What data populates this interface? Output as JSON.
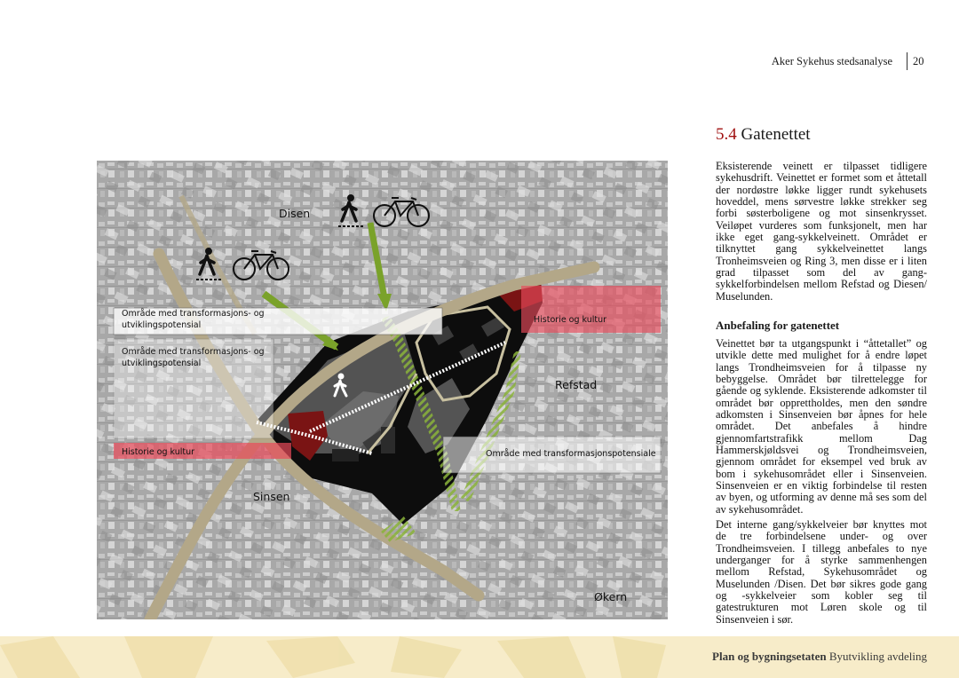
{
  "header": {
    "title": "Aker Sykehus stedsanalyse",
    "page": "20"
  },
  "section": {
    "number": "5.4",
    "title": "Gatenettet"
  },
  "body": {
    "p1": "Eksisterende veinett er tilpasset tidligere sykehusdrift. Veinettet er formet som et åttetall der nordøstre løkke ligger rundt sykehusets hoveddel, mens sørvestre løkke strekker seg forbi søsterboligene og mot sinsenkrysset. Veiløpet vurderes som funksjonelt, men har ikke eget gang-sykkelveinett. Området er tilknyttet gang sykkelveinettet langs Tronheimsveien og Ring 3, men disse er i liten grad tilpasset som del av gang- sykkelforbindelsen mellom Refstad og Diesen/ Muselunden.",
    "subheading": "Anbefaling for gatenettet",
    "p2": "Veinettet bør ta utgangspunkt i “åttetallet” og utvikle dette med mulighet for å endre løpet langs Trondheimsveien for å tilpasse ny bebyggelse. Området bør tilrettelegge for gående og syklende. Eksisterende adkomster til området bør opprettholdes, men den søndre adkomsten i Sinsenveien bør åpnes for hele området. Det anbefales å hindre gjennomfartstrafikk mellom Dag Hammerskjøldsvei og Trondheimsveien, gjennom området for eksempel ved bruk av bom i sykehusområdet eller i Sinsenveien. Sinsenveien er en viktig forbindelse til resten av byen, og utforming av denne må ses som del av sykehusområdet.",
    "p3": "Det interne gang/sykkelveier bør knyttes mot de tre forbindelsene under- og over Trondheimsveien. I tillegg anbefales to nye underganger for å styrke sammenhengen mellom Refstad, Sykehusområdet og Muselunden /Disen. Det bør sikres gode gang og -sykkelveier som kobler seg til gatestrukturen mot Løren skole og til Sinsenveien i sør."
  },
  "map": {
    "places": {
      "disen": "Disen",
      "refstad": "Refstad",
      "sinsen": "Sinsen",
      "okern": "Økern"
    },
    "zones": {
      "transform_1": "Område med transformasjons- og utviklingspotensial",
      "transform_2": "Område med transformasjons- og utviklingspotensial",
      "history_1": "Historie og kultur",
      "history_2": "Historie og kultur",
      "transform_3": "Område med transformasjonspotensiale"
    },
    "icons": [
      "pedestrian-icon",
      "bicycle-icon"
    ],
    "colors": {
      "history": "#e94a5a",
      "road": "#b3a788",
      "green_link": "#7aa22a",
      "site": "#0d0d0d"
    }
  },
  "footer": {
    "org": "Plan og bygningsetaten",
    "dept": "Byutvikling avdeling"
  }
}
